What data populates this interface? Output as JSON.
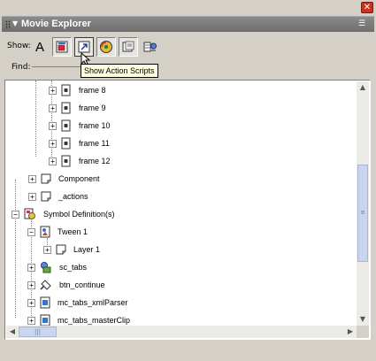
{
  "panel": {
    "title": "Movie Explorer"
  },
  "toolbar": {
    "show_label": "Show:",
    "buttons": [
      {
        "name": "show-text-button",
        "icon": "text-A-icon"
      },
      {
        "name": "show-buttons-movieclips-graphics-button",
        "icon": "movieclip-icon"
      },
      {
        "name": "show-action-scripts-button",
        "icon": "action-script-icon"
      },
      {
        "name": "show-video-sounds-bitmaps-button",
        "icon": "media-icon"
      },
      {
        "name": "show-frames-layers-button",
        "icon": "frames-icon"
      },
      {
        "name": "customize-items-button",
        "icon": "filter-icon"
      }
    ],
    "tooltip": "Show Action Scripts"
  },
  "find": {
    "label": "Find:",
    "value": ""
  },
  "tree": {
    "rows": [
      {
        "label": "frame 8",
        "icon": "frame-icon"
      },
      {
        "label": "frame 9",
        "icon": "frame-icon"
      },
      {
        "label": "frame 10",
        "icon": "frame-icon"
      },
      {
        "label": "frame 11",
        "icon": "frame-icon"
      },
      {
        "label": "frame 12",
        "icon": "frame-icon"
      },
      {
        "label": "Component",
        "icon": "layer-icon"
      },
      {
        "label": "_actions",
        "icon": "layer-icon"
      },
      {
        "label": "Symbol Definition(s)",
        "icon": "symbol-definitions-icon"
      },
      {
        "label": "Tween 1",
        "icon": "graphic-symbol-icon"
      },
      {
        "label": "Layer 1",
        "icon": "layer-icon"
      },
      {
        "label": "sc_tabs",
        "icon": "component-icon"
      },
      {
        "label": "btn_continue",
        "icon": "button-symbol-icon"
      },
      {
        "label": "mc_tabs_xmlParser",
        "icon": "movieclip-icon"
      },
      {
        "label": "mc_tabs_masterClip",
        "icon": "movieclip-icon"
      }
    ]
  }
}
